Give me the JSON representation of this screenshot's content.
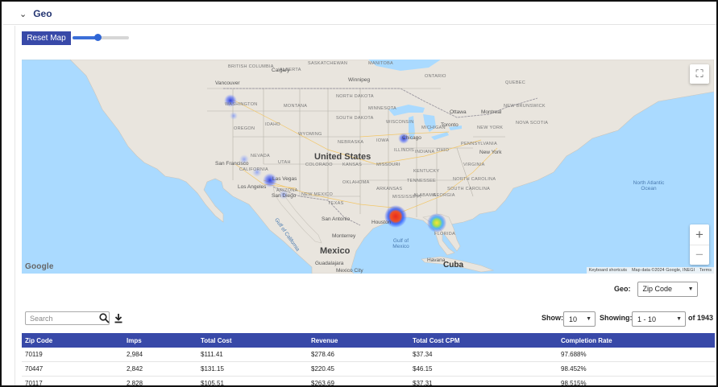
{
  "section": {
    "title": "Geo"
  },
  "toolbar": {
    "reset_label": "Reset Map",
    "slider_value": 0.45
  },
  "map": {
    "labels": {
      "vancouver": "Vancouver",
      "washington": "WASHINGTON",
      "oregon": "OREGON",
      "idaho": "IDAHO",
      "montana": "MONTANA",
      "wyoming": "WYOMING",
      "nevada": "NEVADA",
      "utah": "UTAH",
      "colorado": "COLORADO",
      "california": "CALIFORNIA",
      "arizona": "ARIZONA",
      "new_mexico": "NEW MEXICO",
      "texas": "TEXAS",
      "north_dakota": "NORTH DAKOTA",
      "south_dakota": "SOUTH DAKOTA",
      "nebraska": "NEBRASKA",
      "kansas": "KANSAS",
      "oklahoma": "OKLAHOMA",
      "minnesota": "MINNESOTA",
      "iowa": "IOWA",
      "missouri": "MISSOURI",
      "arkansas": "ARKANSAS",
      "mississippi": "MISSISSIPPI",
      "alabama": "ALABAMA",
      "georgia": "GEORGIA",
      "tennessee": "TENNESSEE",
      "kentucky": "KENTUCKY",
      "illinois": "ILLINOIS",
      "indiana": "INDIANA",
      "ohio": "OHIO",
      "michigan": "MICHIGAN",
      "wisconsin": "WISCONSIN",
      "pennsylvania": "PENNSYLVANIA",
      "new_york_state": "NEW YORK",
      "south_carolina": "SOUTH CAROLINA",
      "north_carolina": "NORTH CAROLINA",
      "virginia": "VIRGINIA",
      "quebec": "QUEBEC",
      "ontario": "ONTARIO",
      "manitoba": "MANITOBA",
      "saskatchewan": "SASKATCHEWAN",
      "alberta": "ALBERTA",
      "british_columbia": "BRITISH COLUMBIA",
      "new_brunswick": "NEW BRUNSWICK",
      "nova_scotia": "NOVA SCOTIA",
      "calgary": "Calgary",
      "winnipeg": "Winnipeg",
      "ottawa": "Ottawa",
      "montreal": "Montreal",
      "toronto": "Toronto",
      "chicago": "Chicago",
      "new_york_city": "New York",
      "san_francisco": "San Francisco",
      "las_vegas": "Las Vegas",
      "los_angeles": "Los Angeles",
      "san_diego": "San Diego",
      "san_antonio": "San Antonio",
      "houston": "Houston",
      "monterrey": "Monterrey",
      "guadalajara": "Guadalajara",
      "mexico_city": "Mexico City",
      "havana": "Havana",
      "united_states": "United States",
      "mexico": "Mexico",
      "cuba": "Cuba",
      "north_atlantic": "North Atlantic Ocean",
      "gulf": "Gulf of Mexico",
      "gulf_california": "Gulf of California",
      "florida": "FLORIDA"
    },
    "google": "Google",
    "attribution": [
      "Keyboard shortcuts",
      "Map data ©2024 Google, INEGI",
      "Terms"
    ],
    "fullscreen_icon": "fullscreen-icon",
    "zoom_in": "+",
    "zoom_out": "−"
  },
  "filters": {
    "geo_label": "Geo:",
    "geo_value": "Zip Code",
    "search_placeholder": "Search"
  },
  "pagination": {
    "show_label": "Show:",
    "show_value": "10",
    "showing_label": "Showing:",
    "showing_value": "1 - 10",
    "of_total": "of 1943"
  },
  "table": {
    "columns": [
      "Zip Code",
      "Imps",
      "Total Cost",
      "Revenue",
      "Total Cost CPM",
      "Completion Rate"
    ],
    "rows": [
      [
        "70119",
        "2,984",
        "$111.41",
        "$278.46",
        "$37.34",
        "97.688%"
      ],
      [
        "70447",
        "2,842",
        "$131.15",
        "$220.45",
        "$46.15",
        "98.452%"
      ],
      [
        "70117",
        "2,828",
        "$105.51",
        "$263.69",
        "$37.31",
        "98.515%"
      ]
    ]
  },
  "colors": {
    "accent": "#3849a8",
    "title": "#243572",
    "water": "#aadaff",
    "land": "#e8e4dd"
  }
}
